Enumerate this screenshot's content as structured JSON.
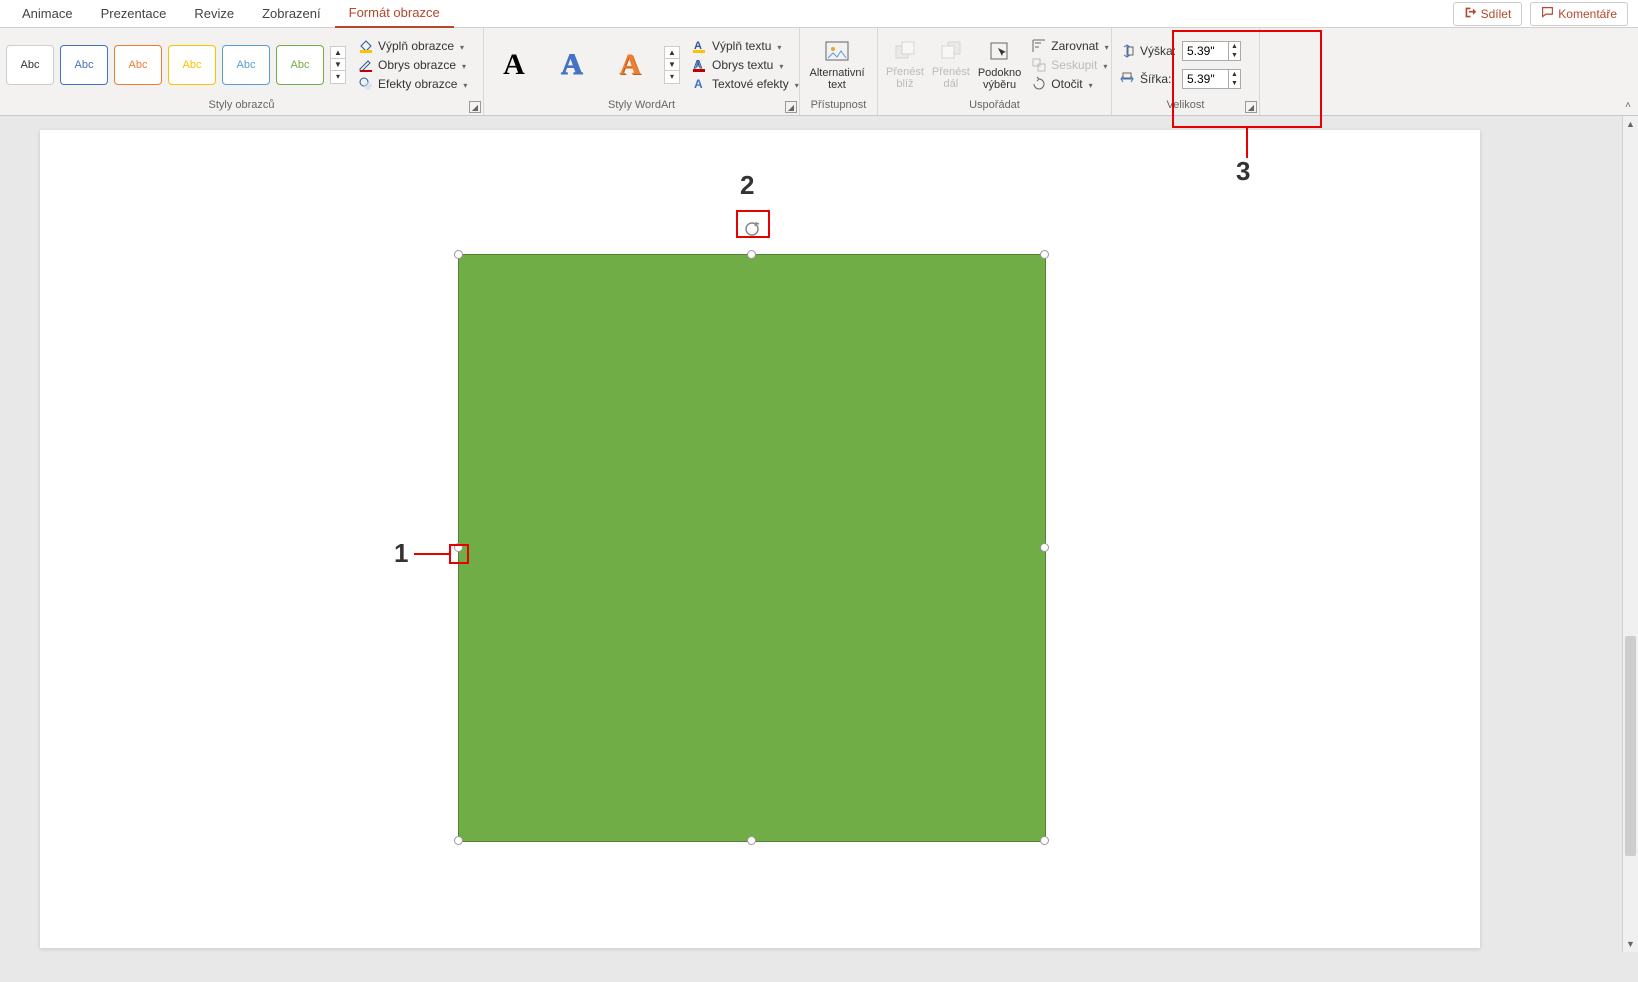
{
  "tabs": {
    "items": [
      "Animace",
      "Prezentace",
      "Revize",
      "Zobrazení",
      "Formát obrazce"
    ],
    "activeIndex": 4
  },
  "top_right": {
    "share": "Sdílet",
    "comments": "Komentáře"
  },
  "ribbon": {
    "shape_styles": {
      "label": "Styly obrazců",
      "gallery_item": "Abc",
      "fill": "Výplň obrazce",
      "outline": "Obrys obrazce",
      "effects": "Efekty obrazce"
    },
    "wordart": {
      "label": "Styly WordArt",
      "sample": "A",
      "textfill": "Výplň textu",
      "textoutline": "Obrys textu",
      "texteffects": "Textové efekty"
    },
    "accessibility": {
      "label": "Přístupnost",
      "alttext": "Alternativní text"
    },
    "arrange": {
      "label": "Uspořádat",
      "bring_forward": "Přenést blíž",
      "send_backward": "Přenést dál",
      "selection_pane": "Podokno výběru",
      "align": "Zarovnat",
      "group": "Seskupit",
      "rotate": "Otočit"
    },
    "size": {
      "label": "Velikost",
      "height_label": "Výška:",
      "width_label": "Šířka:",
      "height_value": "5.39\"",
      "width_value": "5.39\""
    }
  },
  "annotations": {
    "n1": "1",
    "n2": "2",
    "n3": "3"
  }
}
